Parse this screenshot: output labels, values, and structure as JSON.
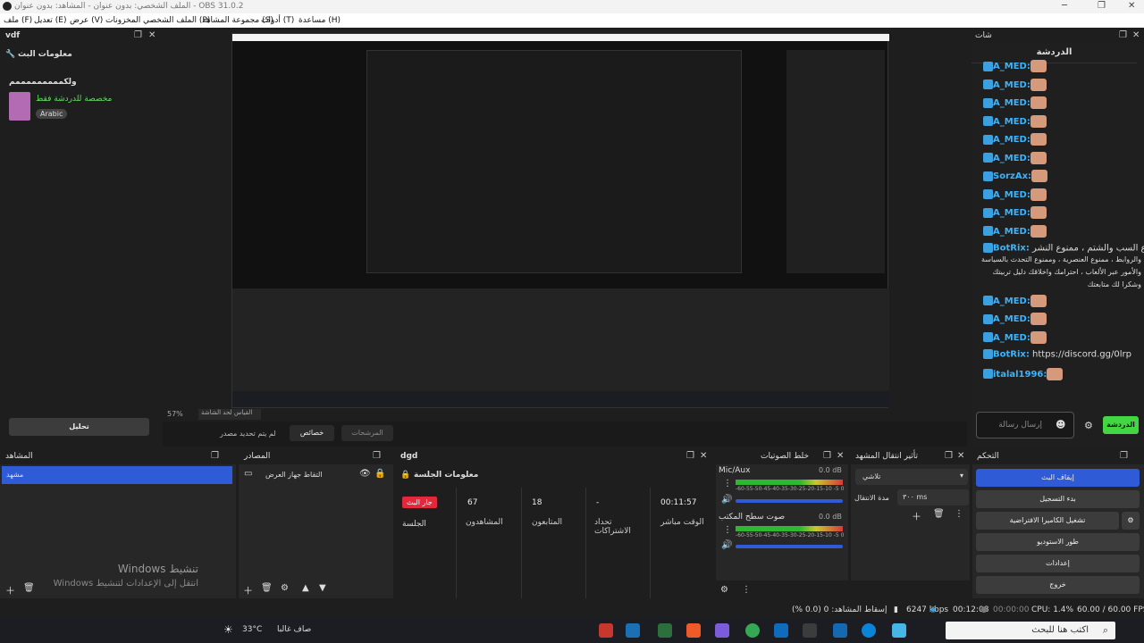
{
  "window": {
    "title": "OBS 31.0.2 - الملف الشخصي: بدون عنوان - المشاهد: بدون عنوان"
  },
  "menu": [
    "ملف (F)",
    "تعديل (E)",
    "عرض (V)",
    "المخزونات",
    "الملف الشخصي (P)",
    "مجموعة المشاهد (S)",
    "أدوات (T)",
    "مساعدة (H)"
  ],
  "left_dock": {
    "tab": "vdf",
    "header": "معلومات البث",
    "stream_title": "ولكمممممممممم",
    "category": "مخصصة للدردشة فقط",
    "tag": "Arabic",
    "edit_button": "تحليل"
  },
  "chat_dock": {
    "tab": "شات",
    "header": "الدردشة",
    "lines": [
      {
        "user": "A_MED:"
      },
      {
        "user": "A_MED:"
      },
      {
        "user": "A_MED:"
      },
      {
        "user": "A_MED:"
      },
      {
        "user": "A_MED:"
      },
      {
        "user": "A_MED:"
      },
      {
        "user": "SorzAx:"
      },
      {
        "user": "A_MED:"
      },
      {
        "user": "A_MED:"
      },
      {
        "user": "A_MED:"
      }
    ],
    "bot_message": {
      "user": "BotRix:",
      "text1": "ممنوع السب والشتم ، ممنوع النشر",
      "text2": "والروابط ، ممنوع العنصرية ، وممنوع التحدث بالسياسة",
      "text3": "والأمور عبر الألعاب ، احترامك واخلاقك دليل تربيتك",
      "text4": "وشكرا لك متابعتك"
    },
    "after": [
      {
        "user": "A_MED:"
      },
      {
        "user": "A_MED:"
      },
      {
        "user": "A_MED:"
      }
    ],
    "bot_link": {
      "user": "BotRix:",
      "text": "https://discord.gg/0lrp"
    },
    "last": {
      "user": "italal1996:"
    },
    "input_placeholder": "إرسال رسالة",
    "send_button": "الدردشة"
  },
  "preview": {
    "zoom": "57%",
    "fit_label": "القياس لحد الشاشة",
    "no_source": "لم يتم تحديد مصدر",
    "props_button": "خصائص",
    "filters_button": "المرشحات"
  },
  "scenes": {
    "title": "المشاهد",
    "items": [
      "مشهد"
    ]
  },
  "sources": {
    "title": "المصادر",
    "items": [
      {
        "name": "التقاط جهاز العرض"
      }
    ]
  },
  "dgd": {
    "title": "dgd",
    "header": "معلومات الجلسة",
    "live_badge": "جار البث",
    "session": "الجلسة",
    "viewers_val": "67",
    "viewers": "المشاهدون",
    "followers_val": "18",
    "followers": "المتابعون",
    "subs_val": "-",
    "subs": "تحداد الاشتراكات",
    "uptime_val": "00:11:57",
    "uptime": "الوقت مباشر"
  },
  "mixer": {
    "title": "خلط الصوتيات",
    "ch1": {
      "name": "Mic/Aux",
      "db": "0.0 dB"
    },
    "ch2": {
      "name": "صوت سطح المكتب",
      "db": "0.0 dB"
    },
    "scale": "-60-55-50-45-40-35-30-25-20-15-10 -5  0"
  },
  "transitions": {
    "title": "تأثير انتقال المشهد",
    "selected": "تلاشي",
    "duration_label": "مدة الانتقال",
    "duration": "٣٠٠ ms"
  },
  "controls": {
    "title": "التحكم",
    "buttons": [
      "إيقاف البث",
      "بدء التسجيل",
      "تشغيل الكاميرا الافتراضية",
      "طور الاستوديو",
      "إعدادات",
      "خروج"
    ]
  },
  "statusbar": {
    "dropped": "إسقاط المشاهد: 0 (0.0 %)",
    "bitrate": "6247 kbps",
    "live": "00:12:08",
    "rec": "00:00:00",
    "cpu": "CPU: 1.4%",
    "fps": "60.00 / 60.00 FPS"
  },
  "watermark": {
    "line1": "تنشيط Windows",
    "line2": "انتقل إلى الإعدادات لتنشيط Windows"
  },
  "taskbar": {
    "search": "اكتب هنا للبحث",
    "weather": "صاف غالبا",
    "temp": "33°C"
  },
  "colors": {
    "accent": "#2f5cd6",
    "live": "#e2283b",
    "green": "#42d642",
    "chat_user": "#3bb4ff"
  }
}
